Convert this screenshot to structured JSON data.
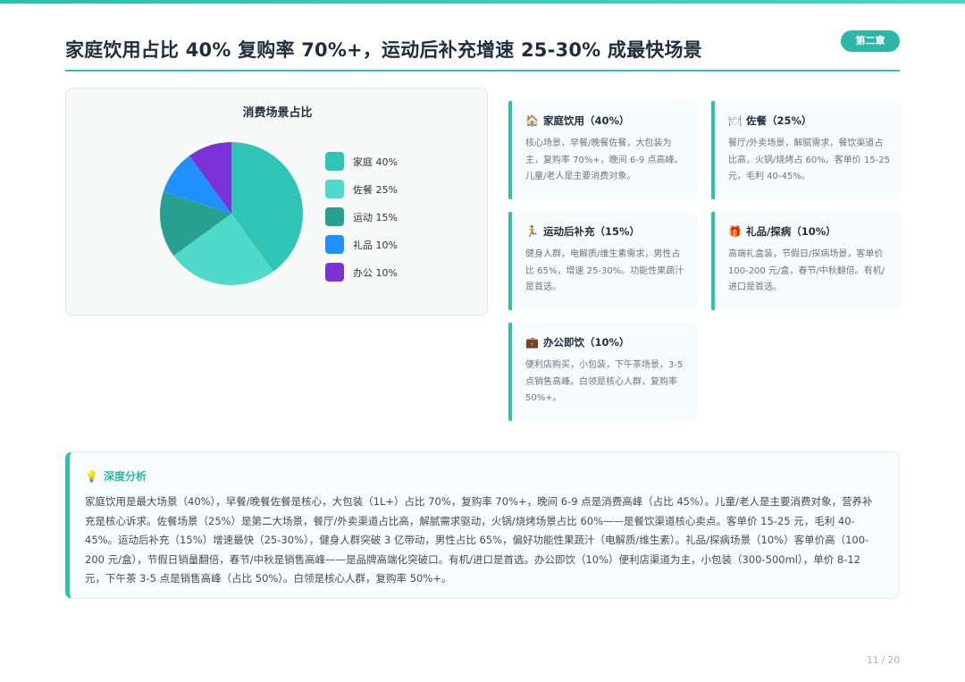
{
  "header": {
    "title": "家庭饮用占比 40% 复购率 70%+，运动后补充增速 25-30% 成最快场景",
    "chapter": "第二章"
  },
  "chart_data": {
    "type": "pie",
    "title": "消费场景占比",
    "categories": [
      "家庭",
      "佐餐",
      "运动",
      "礼品",
      "办公"
    ],
    "values": [
      40,
      25,
      15,
      10,
      10
    ],
    "unit": "%",
    "legend_labels": [
      "家庭 40%",
      "佐餐 25%",
      "运动 15%",
      "礼品 10%",
      "办公 10%"
    ],
    "colors": [
      "#2ec4b6",
      "#4fd9c8",
      "#28a091",
      "#1e90ff",
      "#7a32d6"
    ],
    "legend_position": "right"
  },
  "scenes": [
    {
      "icon": "house-icon",
      "glyph": "🏠",
      "color": "#e07a3a",
      "title": "家庭饮用（40%）",
      "desc": "核心场景，早餐/晚餐佐餐，大包装为主，复购率 70%+，晚间 6-9 点高峰。儿童/老人是主要消费对象。"
    },
    {
      "icon": "plate-icon",
      "glyph": "🍽",
      "color": "#8a8fa0",
      "title": "佐餐（25%）",
      "desc": "餐厅/外卖场景，解腻需求，餐饮渠道占比高，火锅/烧烤占 60%。客单价 15-25 元，毛利 40-45%。"
    },
    {
      "icon": "runner-icon",
      "glyph": "🏃",
      "color": "#e8a020",
      "title": "运动后补充（15%）",
      "desc": "健身人群，电解质/维生素需求，男性占比 65%，增速 25-30%。功能性果蔬汁是首选。"
    },
    {
      "icon": "gift-icon",
      "glyph": "🎁",
      "color": "#d94040",
      "title": "礼品/探病（10%）",
      "desc": "高端礼盒装，节假日/探病场景，客单价 100-200 元/盒，春节/中秋翻倍。有机/进口是首选。"
    },
    {
      "icon": "briefcase-icon",
      "glyph": "💼",
      "color": "#8a5a2b",
      "title": "办公即饮（10%）",
      "desc": "便利店购买，小包装，下午茶场景，3-5 点销售高峰。白领是核心人群，复购率 50%+。"
    }
  ],
  "analysis": {
    "icon": "lightbulb-icon",
    "title": "深度分析",
    "body": "家庭饮用是最大场景（40%），早餐/晚餐佐餐是核心，大包装（1L+）占比 70%，复购率 70%+，晚间 6-9 点是消费高峰（占比 45%）。儿童/老人是主要消费对象，营养补充是核心诉求。佐餐场景（25%）是第二大场景，餐厅/外卖渠道占比高，解腻需求驱动，火锅/烧烤场景占比 60%——是餐饮渠道核心卖点。客单价 15-25 元，毛利 40-45%。运动后补充（15%）增速最快（25-30%），健身人群突破 3 亿带动，男性占比 65%，偏好功能性果蔬汁（电解质/维生素）。礼品/探病场景（10%）客单价高（100-200 元/盒），节假日销量翻倍，春节/中秋是销售高峰——是品牌高端化突破口。有机/进口是首选。办公即饮（10%）便利店渠道为主，小包装（300-500ml），单价 8-12 元，下午茶 3-5 点是销售高峰（占比 50%）。白领是核心人群，复购率 50%+。"
  },
  "footer": {
    "page": "11 / 20"
  }
}
